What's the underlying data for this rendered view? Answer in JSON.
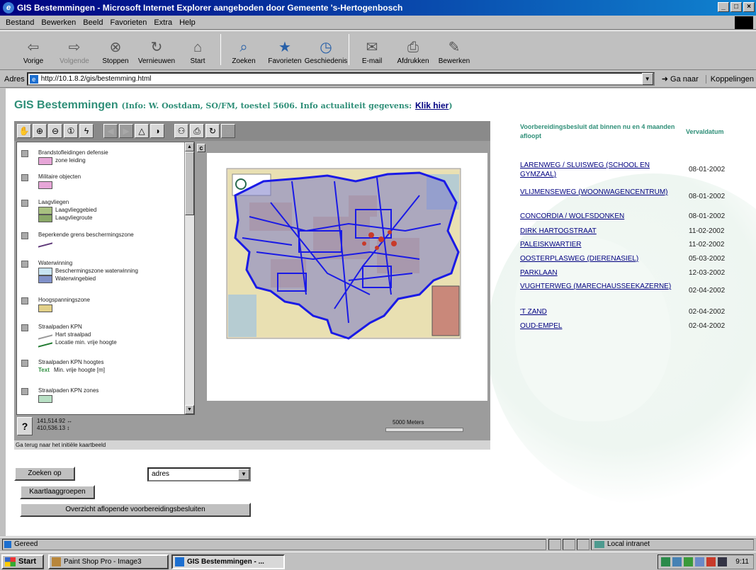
{
  "window": {
    "title": "GIS Bestemmingen - Microsoft Internet Explorer aangeboden door Gemeente 's-Hertogenbosch",
    "controls": [
      "_",
      "□",
      "×"
    ]
  },
  "menu": [
    "Bestand",
    "Bewerken",
    "Beeld",
    "Favorieten",
    "Extra",
    "Help"
  ],
  "toolbar": [
    {
      "label": "Vorige",
      "icon": "back-arrow-icon",
      "glyph": "⇦",
      "disabled": false
    },
    {
      "label": "Volgende",
      "icon": "forward-arrow-icon",
      "glyph": "⇨",
      "disabled": true
    },
    {
      "label": "Stoppen",
      "icon": "stop-icon",
      "glyph": "⊗",
      "disabled": false
    },
    {
      "label": "Vernieuwen",
      "icon": "refresh-icon",
      "glyph": "↻",
      "disabled": false
    },
    {
      "label": "Start",
      "icon": "home-icon",
      "glyph": "⌂",
      "disabled": false
    },
    {
      "label": "Zoeken",
      "icon": "search-icon",
      "glyph": "⌕",
      "disabled": false
    },
    {
      "label": "Favorieten",
      "icon": "favorites-icon",
      "glyph": "★",
      "disabled": false
    },
    {
      "label": "Geschiedenis",
      "icon": "history-icon",
      "glyph": "◷",
      "disabled": false
    },
    {
      "label": "E-mail",
      "icon": "mail-icon",
      "glyph": "✉",
      "disabled": false
    },
    {
      "label": "Afdrukken",
      "icon": "print-icon",
      "glyph": "⎙",
      "disabled": false
    },
    {
      "label": "Bewerken",
      "icon": "edit-icon",
      "glyph": "✎",
      "disabled": false
    }
  ],
  "address": {
    "label": "Adres",
    "url": "http://10.1.8.2/gis/bestemming.html",
    "go_label": "Ga naar",
    "links_label": "Koppelingen"
  },
  "page": {
    "title_main": "GIS Bestemmingen",
    "title_info": "(Info: W. Oostdam, SO/FM, toestel 5606. Info actualiteit gegevens:",
    "title_link": "Klik hier",
    "title_close": ")"
  },
  "map_tools": [
    {
      "icon": "pan-hand-icon",
      "glyph": "✋",
      "dim": false
    },
    {
      "icon": "zoom-in-icon",
      "glyph": "⊕",
      "dim": false
    },
    {
      "icon": "zoom-out-icon",
      "glyph": "⊖",
      "dim": false
    },
    {
      "icon": "info-icon",
      "glyph": "①",
      "dim": false
    },
    {
      "icon": "lightning-icon",
      "glyph": "ϟ",
      "dim": false
    },
    {
      "icon": "prev-extent-icon",
      "glyph": "◀",
      "dim": true
    },
    {
      "icon": "next-extent-icon",
      "glyph": "▶",
      "dim": true
    },
    {
      "icon": "select-icon",
      "glyph": "△",
      "dim": false
    },
    {
      "icon": "clear-select-icon",
      "glyph": "◑",
      "dim": false
    },
    {
      "icon": "binoculars-icon",
      "glyph": "⚇",
      "dim": false
    },
    {
      "icon": "print-map-icon",
      "glyph": "⎙",
      "dim": false
    },
    {
      "icon": "refresh-map-icon",
      "glyph": "↻",
      "dim": false
    },
    {
      "icon": "extra-tool-icon",
      "glyph": "◌",
      "dim": true
    }
  ],
  "legend": [
    {
      "title": "Brandstofleidingen defensie",
      "subs": [
        {
          "label": "zone leiding",
          "color": "#e7a6d8"
        }
      ]
    },
    {
      "title": "Militaire objecten",
      "subs": [
        {
          "label": "",
          "color": "#e7a6d8"
        }
      ]
    },
    {
      "title": "Laagvliegen",
      "subs": [
        {
          "label": "Laagvlieggebied",
          "color": "#a8c080"
        },
        {
          "label": "Laagvliegroute",
          "color": "#8aa868"
        }
      ]
    },
    {
      "title": "Beperkende grens beschermingszone",
      "subs": [
        {
          "label": "",
          "color": "line-purple"
        }
      ]
    },
    {
      "title": "Waterwinning",
      "subs": [
        {
          "label": "Beschermingszone waterwinning",
          "color": "#c8e4f2"
        },
        {
          "label": "Waterwingebied",
          "color": "#8090c8"
        }
      ]
    },
    {
      "title": "Hoogspanningszone",
      "subs": [
        {
          "label": "",
          "color": "#e2d088"
        }
      ]
    },
    {
      "title": "Straalpaden KPN",
      "subs": [
        {
          "label": "Hart straalpad",
          "color": "line-grey"
        },
        {
          "label": "Locatie min. vrije hoogte",
          "color": "line-green"
        }
      ]
    },
    {
      "title": "Straalpaden KPN hoogtes",
      "subs": [
        {
          "label": "Min. vrije hoogte [m]",
          "prefix": "Text",
          "color": "text-green"
        }
      ]
    },
    {
      "title": "Straalpaden KPN zones",
      "subs": [
        {
          "label": "",
          "color": "#b8e0c4"
        }
      ]
    }
  ],
  "coords": {
    "x": "141,514.92 ↔",
    "y": "410,536.13 ↕"
  },
  "scale_label": "5000 Meters",
  "map_status": "Ga terug naar het initiële kaartbeeld",
  "form": {
    "search_button": "Zoeken op",
    "select_value": "adres",
    "layers_button": "Kaartlaaggroepen",
    "overview_button": "Overzicht aflopende voorbereidingsbesluiten"
  },
  "list": {
    "header_left": "Voorbereidingsbesluit dat binnen nu en 4 maanden afloopt",
    "header_right": "Vervaldatum",
    "rows": [
      {
        "name": "LARENWEG / SLUISWEG (SCHOOL EN GYMZAAL)",
        "date": "08-01-2002"
      },
      {
        "name": "VLIJMENSEWEG (WOONWAGENCENTRUM)",
        "date": "08-01-2002"
      },
      {
        "name": "CONCORDIA / WOLFSDONKEN",
        "date": "08-01-2002"
      },
      {
        "name": "DIRK HARTOGSTRAAT",
        "date": "11-02-2002"
      },
      {
        "name": "PALEISKWARTIER",
        "date": "11-02-2002"
      },
      {
        "name": "OOSTERPLASWEG (DIERENASIEL)",
        "date": "05-03-2002"
      },
      {
        "name": "PARKLAAN",
        "date": "12-03-2002"
      },
      {
        "name": "VUGHTERWEG (MARECHAUSSEEKAZERNE)",
        "date": "02-04-2002"
      },
      {
        "name": "'T ZAND",
        "date": "02-04-2002"
      },
      {
        "name": "OUD-EMPEL",
        "date": "02-04-2002"
      }
    ]
  },
  "status": {
    "text": "Gereed",
    "zone": "Local intranet"
  },
  "taskbar": {
    "start": "Start",
    "tasks": [
      "Paint Shop Pro - Image3",
      "GIS Bestemmingen - ..."
    ],
    "clock": "9:11"
  },
  "colors": {
    "title_green": "#2f8f78",
    "link_blue": "#000080",
    "map_blue": "#1a1ae6"
  }
}
